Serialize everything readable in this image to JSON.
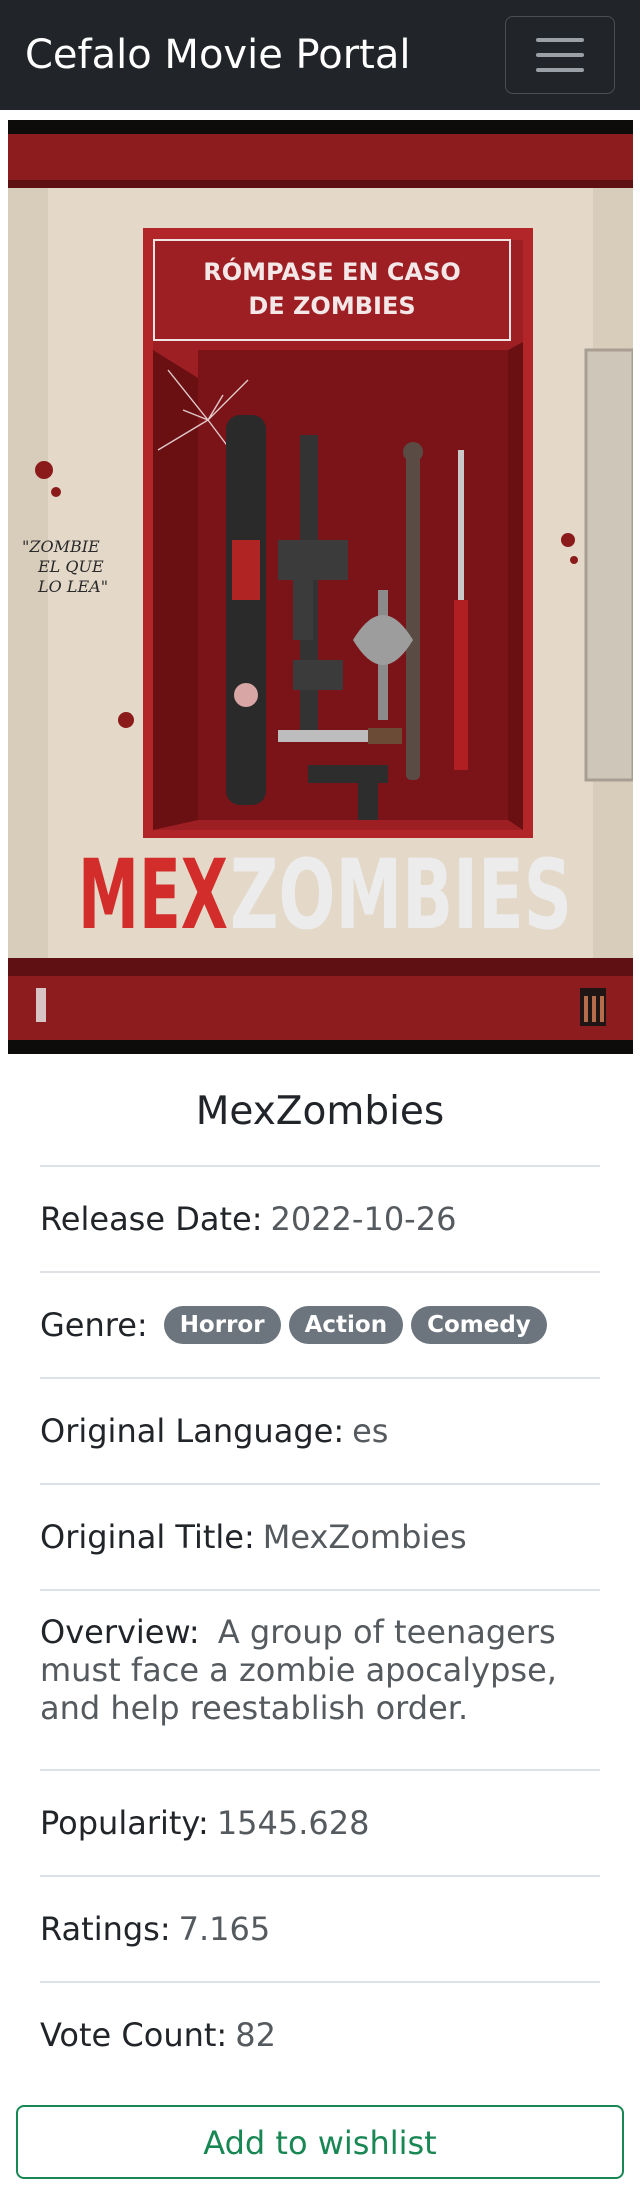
{
  "navbar": {
    "brand": "Cefalo Movie Portal",
    "toggler_icon": "hamburger-menu-icon"
  },
  "poster": {
    "case_sign_line1": "RÓMPASE EN CASO",
    "case_sign_line2": "DE ZOMBIES",
    "title_part1": "MEX",
    "title_part2": "ZOMBIES",
    "graffiti": "\"ZOMBIE EL QUE LO LEA\"",
    "colors": {
      "frame": "#8d1c1f",
      "case_inner": "#7a1418",
      "wall": "#e4d9c9",
      "title_red": "#d32d2b",
      "title_white": "#ececec"
    }
  },
  "movie": {
    "title": "MexZombies",
    "release_date_label": "Release Date:",
    "release_date": "2022-10-26",
    "genre_label": "Genre:",
    "genres": [
      "Horror",
      "Action",
      "Comedy"
    ],
    "language_label": "Original Language:",
    "language": "es",
    "original_title_label": "Original Title:",
    "original_title": "MexZombies",
    "overview_label": "Overview:",
    "overview": "A group of teenagers must face a zombie apocalypse, and help reestablish order.",
    "popularity_label": "Popularity:",
    "popularity": "1545.628",
    "ratings_label": "Ratings:",
    "ratings": "7.165",
    "vote_count_label": "Vote Count:",
    "vote_count": "82"
  },
  "actions": {
    "wishlist_label": "Add to wishlist",
    "accent": "#198754"
  }
}
